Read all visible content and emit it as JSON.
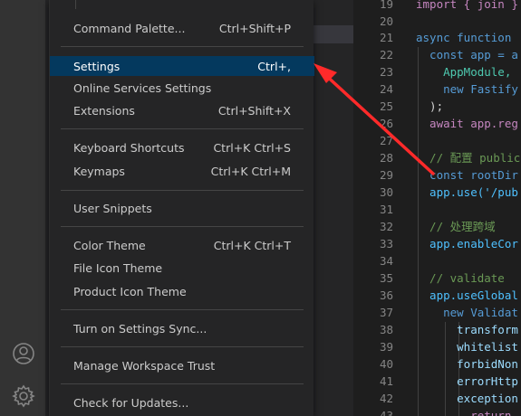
{
  "menu": {
    "items": [
      {
        "label": "Command Palette...",
        "shortcut": "Ctrl+Shift+P"
      },
      {
        "label": "Settings",
        "shortcut": "Ctrl+,"
      },
      {
        "label": "Online Services Settings",
        "shortcut": ""
      },
      {
        "label": "Extensions",
        "shortcut": "Ctrl+Shift+X"
      },
      {
        "label": "Keyboard Shortcuts",
        "shortcut": "Ctrl+K Ctrl+S"
      },
      {
        "label": "Keymaps",
        "shortcut": "Ctrl+K Ctrl+M"
      },
      {
        "label": "User Snippets",
        "shortcut": ""
      },
      {
        "label": "Color Theme",
        "shortcut": "Ctrl+K Ctrl+T"
      },
      {
        "label": "File Icon Theme",
        "shortcut": ""
      },
      {
        "label": "Product Icon Theme",
        "shortcut": ""
      },
      {
        "label": "Turn on Settings Sync...",
        "shortcut": ""
      },
      {
        "label": "Manage Workspace Trust",
        "shortcut": ""
      },
      {
        "label": "Check for Updates...",
        "shortcut": ""
      }
    ],
    "active_item": "Settings"
  },
  "activity_bar": {
    "icons": [
      "account-icon",
      "gear-icon"
    ]
  },
  "editor": {
    "line_numbers": [
      "19",
      "20",
      "21",
      "22",
      "23",
      "24",
      "25",
      "26",
      "27",
      "28",
      "29",
      "30",
      "31",
      "32",
      "33",
      "34",
      "35",
      "36",
      "37",
      "38",
      "39",
      "40",
      "41",
      "42",
      "43"
    ],
    "lines": [
      "import { join }",
      "",
      "async function",
      "  const app = a",
      "    AppModule,",
      "    new Fastify",
      "  );",
      "  await app.reg",
      "",
      "  // 配置 public",
      "  const rootDir",
      "  app.use('/pub",
      "",
      "  // 处理跨域",
      "  app.enableCor",
      "",
      "  // validate",
      "  app.useGlobal",
      "    new Validat",
      "      transform",
      "      whitelist",
      "      forbidNon",
      "      errorHttp",
      "      exception",
      "        return"
    ]
  },
  "colors": {
    "menu_bg": "#252526",
    "menu_active_bg": "#04395e",
    "menu_text": "#cccccc",
    "activity_bar_bg": "#333333",
    "editor_bg": "#1e1e1e",
    "annotation_arrow": "#ff2a2a"
  }
}
